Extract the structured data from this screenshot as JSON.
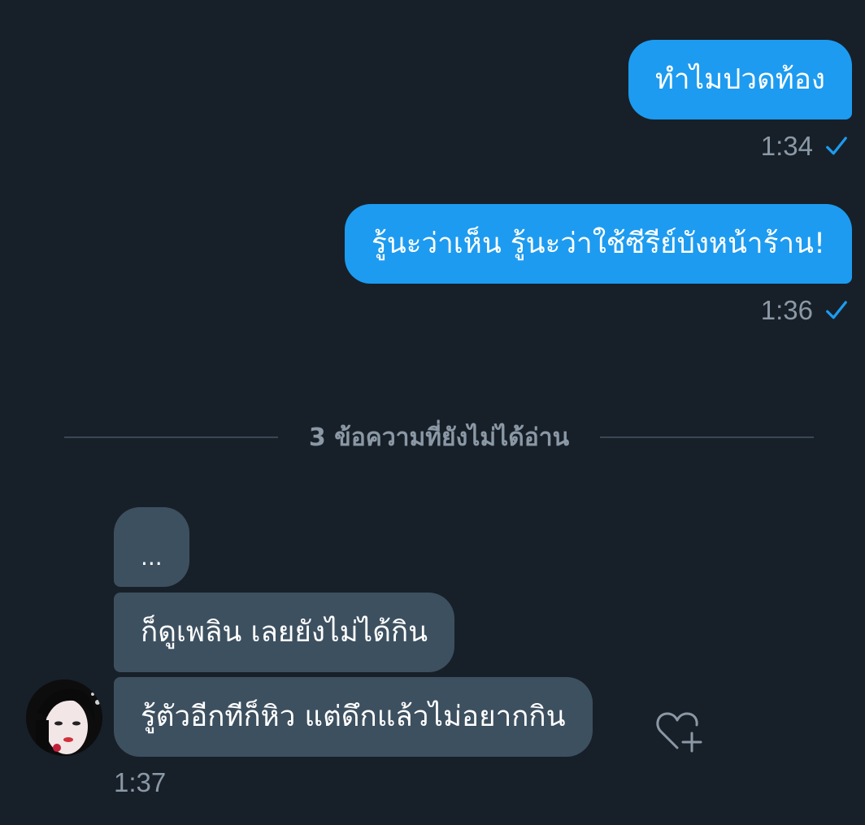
{
  "conversation": {
    "outgoing": [
      {
        "text": "ทำไมปวดท้อง",
        "time": "1:34",
        "status_icon": "check-icon"
      },
      {
        "text": "รู้นะว่าเห็น รู้นะว่าใช้ซีรีย์บังหน้าร้าน!",
        "time": "1:36",
        "status_icon": "check-icon"
      }
    ],
    "unread_divider": "3 ข้อความที่ยังไม่ได้อ่าน",
    "incoming": {
      "messages": [
        {
          "text": "..."
        },
        {
          "text": "ก็ดูเพลิน เลยยังไม่ได้กิน"
        },
        {
          "text": "รู้ตัวอีกทีก็หิว แต่ดึกแล้วไม่อยากกิน"
        }
      ],
      "time": "1:37",
      "reaction_icon": "heart-plus-icon"
    }
  },
  "colors": {
    "background": "#172029",
    "outgoing_bubble": "#1D9BF0",
    "incoming_bubble": "#3D5060",
    "secondary_text": "#8B98A5"
  }
}
